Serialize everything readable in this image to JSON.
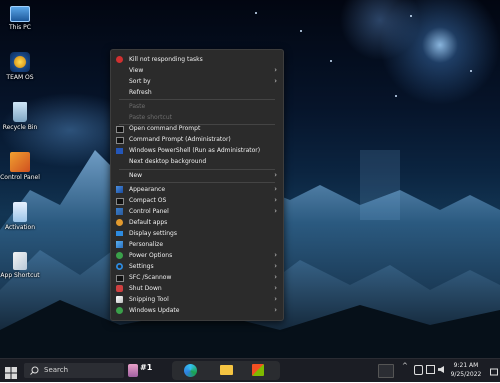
{
  "desktop_icons": [
    {
      "label": "This PC",
      "icon": "monitor-icon"
    },
    {
      "label": "TEAM OS",
      "icon": "team-os-icon"
    },
    {
      "label": "Recycle Bin",
      "icon": "recycle-bin-icon"
    },
    {
      "label": "Control Panel",
      "icon": "control-panel-icon"
    },
    {
      "label": "Activation",
      "icon": "document-icon"
    },
    {
      "label": "App Shortcut",
      "icon": "shortcut-icon"
    }
  ],
  "context_menu": {
    "items": [
      {
        "label": "Kill not responding tasks",
        "icon": "kill-task-icon",
        "enabled": true,
        "submenu": false
      },
      {
        "label": "View",
        "icon": "",
        "enabled": true,
        "submenu": true
      },
      {
        "label": "Sort by",
        "icon": "",
        "enabled": true,
        "submenu": true
      },
      {
        "label": "Refresh",
        "icon": "",
        "enabled": true,
        "submenu": false
      },
      {
        "label": "Paste",
        "icon": "",
        "enabled": false,
        "submenu": false
      },
      {
        "label": "Paste shortcut",
        "icon": "",
        "enabled": false,
        "submenu": false
      },
      {
        "label": "Open command Prompt",
        "icon": "cmd-icon",
        "enabled": true,
        "submenu": false
      },
      {
        "label": "Command Prompt (Administrator)",
        "icon": "cmd-admin-icon",
        "enabled": true,
        "submenu": false
      },
      {
        "label": "Windows PowerShell (Run as Administrator)",
        "icon": "powershell-icon",
        "enabled": true,
        "submenu": false
      },
      {
        "label": "Next desktop background",
        "icon": "",
        "enabled": true,
        "submenu": false
      },
      {
        "label": "New",
        "icon": "",
        "enabled": true,
        "submenu": true
      },
      {
        "label": "Appearance",
        "icon": "appearance-icon",
        "enabled": true,
        "submenu": true
      },
      {
        "label": "Compact OS",
        "icon": "compact-os-icon",
        "enabled": true,
        "submenu": true
      },
      {
        "label": "Control Panel",
        "icon": "control-panel-icon",
        "enabled": true,
        "submenu": true
      },
      {
        "label": "Default apps",
        "icon": "default-apps-icon",
        "enabled": true,
        "submenu": false
      },
      {
        "label": "Display settings",
        "icon": "display-icon",
        "enabled": true,
        "submenu": false
      },
      {
        "label": "Personalize",
        "icon": "personalize-icon",
        "enabled": true,
        "submenu": false
      },
      {
        "label": "Power Options",
        "icon": "power-options-icon",
        "enabled": true,
        "submenu": true
      },
      {
        "label": "Settings",
        "icon": "gear-icon",
        "enabled": true,
        "submenu": true
      },
      {
        "label": "SFC /Scannow",
        "icon": "sfc-icon",
        "enabled": true,
        "submenu": true
      },
      {
        "label": "Shut Down",
        "icon": "shutdown-icon",
        "enabled": true,
        "submenu": true
      },
      {
        "label": "Snipping Tool",
        "icon": "snipping-icon",
        "enabled": true,
        "submenu": true
      },
      {
        "label": "Windows Update",
        "icon": "update-icon",
        "enabled": true,
        "submenu": true
      }
    ]
  },
  "taskbar": {
    "search_label": "Search",
    "badge_text": "#1",
    "time": "9:21 AM",
    "date": "9/25/2022",
    "tray_chevron": "^"
  },
  "colors": {
    "menu_bg": "#2b2b2b",
    "taskbar_bg": "#1b1d24",
    "accent": "#0a84ff",
    "kill_red": "#d03030"
  }
}
